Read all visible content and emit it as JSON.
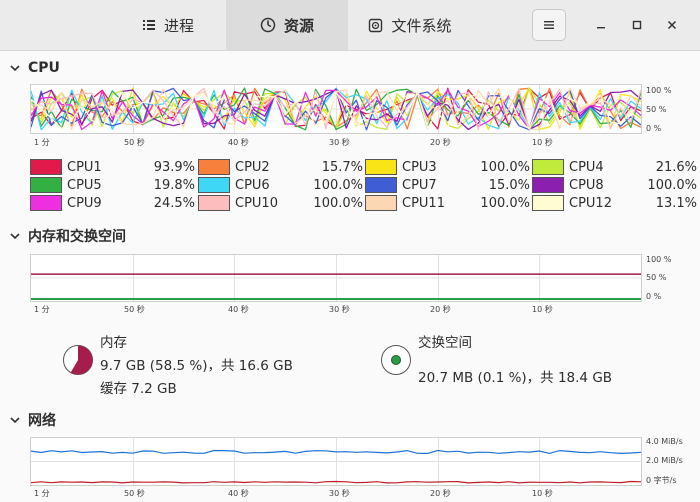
{
  "tabs": [
    {
      "label": "进程",
      "icon": "list-icon"
    },
    {
      "label": "资源",
      "icon": "gauge-icon"
    },
    {
      "label": "文件系统",
      "icon": "disk-icon"
    }
  ],
  "sections": {
    "cpu": "CPU",
    "memory": "内存和交换空间",
    "network": "网络"
  },
  "time_ticks": [
    "1 分",
    "50 秒",
    "40 秒",
    "30 秒",
    "20 秒",
    "10 秒"
  ],
  "percent_ticks": [
    "100 %",
    "50 %",
    "0 %"
  ],
  "net_ticks": [
    "4.0 MiB/s",
    "2.0 MiB/s",
    "0 字节/s"
  ],
  "cpus": [
    {
      "name": "CPU1",
      "value": "93.9%",
      "color": "#e01b4b"
    },
    {
      "name": "CPU2",
      "value": "15.7%",
      "color": "#f6803c"
    },
    {
      "name": "CPU3",
      "value": "100.0%",
      "color": "#f9e418"
    },
    {
      "name": "CPU4",
      "value": "21.6%",
      "color": "#c0ea3c"
    },
    {
      "name": "CPU5",
      "value": "19.8%",
      "color": "#33b043"
    },
    {
      "name": "CPU6",
      "value": "100.0%",
      "color": "#3fd7f6"
    },
    {
      "name": "CPU7",
      "value": "15.0%",
      "color": "#3f5ed6"
    },
    {
      "name": "CPU8",
      "value": "100.0%",
      "color": "#8a1fb0"
    },
    {
      "name": "CPU9",
      "value": "24.5%",
      "color": "#ee2fe0"
    },
    {
      "name": "CPU10",
      "value": "100.0%",
      "color": "#fbbdbd"
    },
    {
      "name": "CPU11",
      "value": "100.0%",
      "color": "#fdd7b3"
    },
    {
      "name": "CPU12",
      "value": "13.1%",
      "color": "#fffbd3"
    }
  ],
  "memory": {
    "label": "内存",
    "usage": "9.7 GB (58.5 %)，共 16.6 GB",
    "cache": "缓存 7.2 GB",
    "fraction": 0.585,
    "color": "#a51d4c"
  },
  "swap": {
    "label": "交换空间",
    "usage": "20.7 MB (0.1 %)，共 18.4 GB",
    "fraction": 0.001,
    "color": "#2a9d46"
  }
}
